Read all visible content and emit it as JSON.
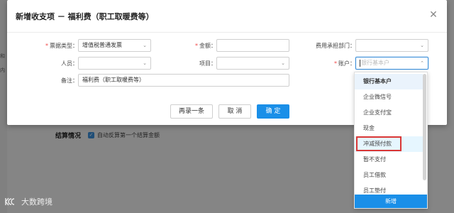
{
  "background": {
    "left_glyphs": [
      "和",
      "内"
    ],
    "settle_title": "结算情况",
    "auto_checkbox_label": "自动反算第一个结算金额"
  },
  "watermark": {
    "text": "大数跨境"
  },
  "dialog": {
    "title": "新增收支项 － 福利费（职工取暖费等）",
    "close_icon": "close-icon",
    "form": {
      "invoice_type": {
        "label": "票据类型",
        "value": "增值税普通发票",
        "required": true
      },
      "amount": {
        "label": "金额",
        "value": "",
        "required": true
      },
      "expense_dept": {
        "label": "费用承担部门",
        "value": ""
      },
      "person": {
        "label": "人员",
        "value": ""
      },
      "project": {
        "label": "项目",
        "value": ""
      },
      "account": {
        "label": "账户",
        "placeholder": "银行基本户",
        "value": "",
        "required": true
      },
      "remark": {
        "label": "备注",
        "value": "福利费（职工取暖费等）"
      }
    },
    "buttons": {
      "record_another": "再录一条",
      "cancel": "取 消",
      "confirm": "确 定"
    }
  },
  "account_dropdown": {
    "items": [
      {
        "label": "银行基本户",
        "state": "selected"
      },
      {
        "label": "企业微信号",
        "state": ""
      },
      {
        "label": "企业支付宝",
        "state": ""
      },
      {
        "label": "现金",
        "state": ""
      },
      {
        "label": "冲减预付款",
        "state": "highlight"
      },
      {
        "label": "暂不支付",
        "state": ""
      },
      {
        "label": "员工借款",
        "state": ""
      },
      {
        "label": "员工垫付",
        "state": ""
      }
    ],
    "add_button": "新增"
  },
  "colors": {
    "primary": "#1a8fe8",
    "required": "#f04848",
    "annotation": "#d93636"
  }
}
